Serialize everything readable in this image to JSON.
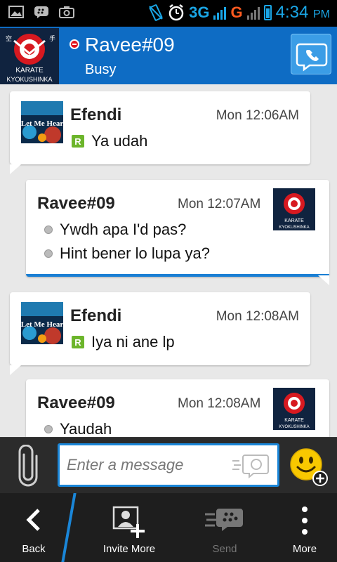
{
  "status_bar": {
    "network_primary": "3G",
    "network_secondary": "G",
    "time": "4:34",
    "ampm": "PM"
  },
  "header": {
    "contact_name": "Ravee#09",
    "status": "Busy",
    "avatar_text_top": "KARATE",
    "avatar_text_bottom": "KYOKUSHINKA"
  },
  "messages": [
    {
      "sender": "Efendi",
      "time": "Mon 12:06AM",
      "lines": [
        "Ya udah"
      ],
      "direction": "in",
      "avatar": "Let Me Hear"
    },
    {
      "sender": "Ravee#09",
      "time": "Mon 12:07AM",
      "lines": [
        "Ywdh apa I'd pas?",
        "Hint bener lo lupa ya?"
      ],
      "direction": "out",
      "avatar": "karate-logo"
    },
    {
      "sender": "Efendi",
      "time": "Mon 12:08AM",
      "lines": [
        "Iya ni ane lp"
      ],
      "direction": "in",
      "avatar": "Let Me Hear"
    },
    {
      "sender": "Ravee#09",
      "time": "Mon 12:08AM",
      "lines": [
        "Yaudah"
      ],
      "direction": "out",
      "avatar": "karate-logo"
    }
  ],
  "read_badge": "R",
  "composer": {
    "placeholder": "Enter a message"
  },
  "bottom_bar": {
    "back": "Back",
    "invite_more": "Invite More",
    "send": "Send",
    "more": "More"
  },
  "colors": {
    "header_bg": "#0e6cc4",
    "accent": "#1a86d8",
    "busy": "#e3121a",
    "read_badge": "#6cb52b"
  }
}
